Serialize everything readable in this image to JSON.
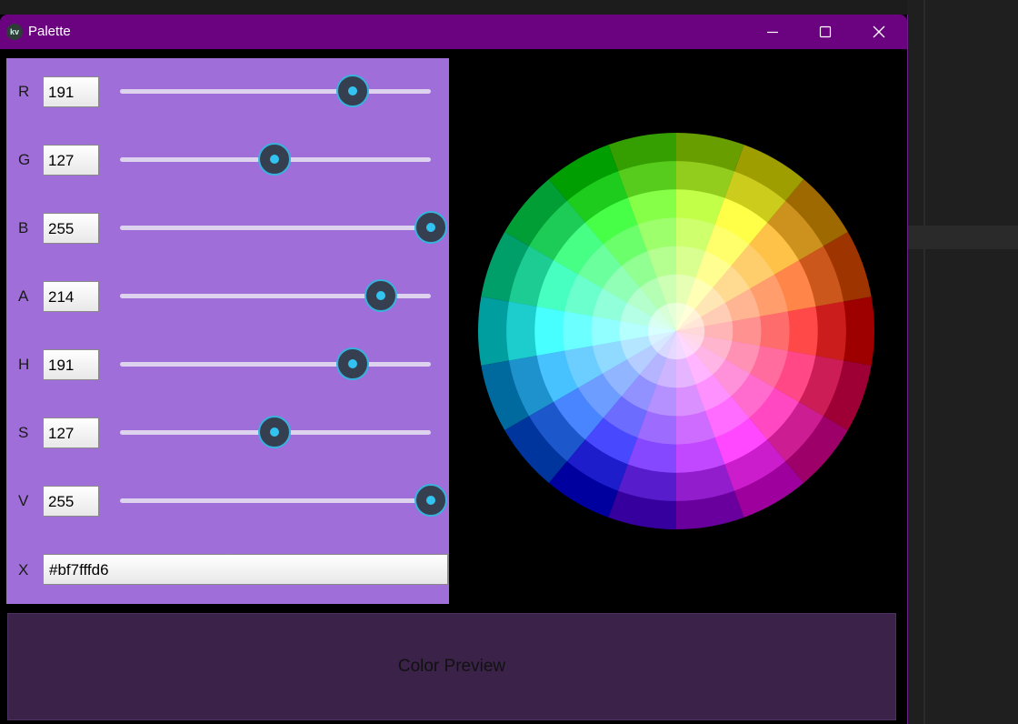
{
  "window": {
    "title": "Palette",
    "icon": "kivy-logo-icon",
    "controls": [
      "minimize-icon",
      "maximize-icon",
      "close-icon"
    ],
    "titlebar_color": "#6b0280"
  },
  "panel_color": "#a06ed8",
  "slider_accent": "#35b3de",
  "channels": [
    {
      "label": "R",
      "value": "191",
      "level": 0.749
    },
    {
      "label": "G",
      "value": "127",
      "level": 0.498
    },
    {
      "label": "B",
      "value": "255",
      "level": 1.0
    },
    {
      "label": "A",
      "value": "214",
      "level": 0.839
    },
    {
      "label": "H",
      "value": "191",
      "level": 0.749
    },
    {
      "label": "S",
      "value": "127",
      "level": 0.498
    },
    {
      "label": "V",
      "value": "255",
      "level": 1.0
    }
  ],
  "hex": {
    "label": "X",
    "value": "#bf7fffd6"
  },
  "color_wheel": {
    "hue_segments": 18,
    "rings": 7
  },
  "preview": {
    "label": "Color Preview",
    "color": "#3a2248"
  }
}
